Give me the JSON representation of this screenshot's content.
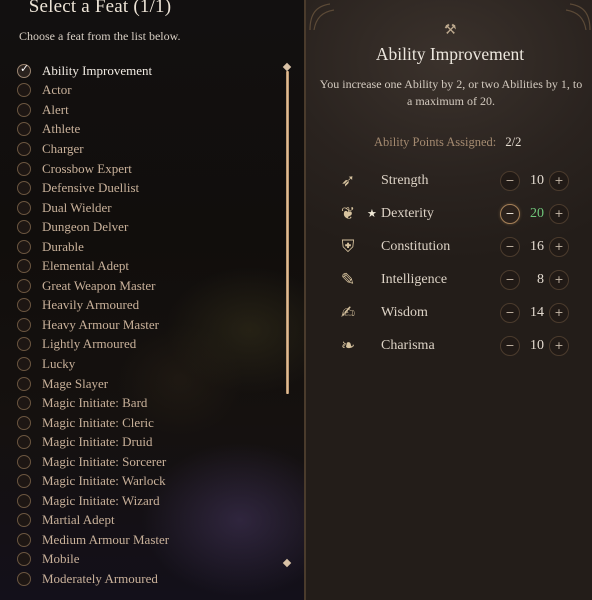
{
  "left": {
    "title": "Select a Feat (1/1)",
    "subtitle": "Choose a feat from the list below.",
    "feats": [
      {
        "label": "Ability Improvement",
        "selected": true
      },
      {
        "label": "Actor",
        "selected": false
      },
      {
        "label": "Alert",
        "selected": false
      },
      {
        "label": "Athlete",
        "selected": false
      },
      {
        "label": "Charger",
        "selected": false
      },
      {
        "label": "Crossbow Expert",
        "selected": false
      },
      {
        "label": "Defensive Duellist",
        "selected": false
      },
      {
        "label": "Dual Wielder",
        "selected": false
      },
      {
        "label": "Dungeon Delver",
        "selected": false
      },
      {
        "label": "Durable",
        "selected": false
      },
      {
        "label": "Elemental Adept",
        "selected": false
      },
      {
        "label": "Great Weapon Master",
        "selected": false
      },
      {
        "label": "Heavily Armoured",
        "selected": false
      },
      {
        "label": "Heavy Armour Master",
        "selected": false
      },
      {
        "label": "Lightly Armoured",
        "selected": false
      },
      {
        "label": "Lucky",
        "selected": false
      },
      {
        "label": "Mage Slayer",
        "selected": false
      },
      {
        "label": "Magic Initiate: Bard",
        "selected": false
      },
      {
        "label": "Magic Initiate: Cleric",
        "selected": false
      },
      {
        "label": "Magic Initiate: Druid",
        "selected": false
      },
      {
        "label": "Magic Initiate: Sorcerer",
        "selected": false
      },
      {
        "label": "Magic Initiate: Warlock",
        "selected": false
      },
      {
        "label": "Magic Initiate: Wizard",
        "selected": false
      },
      {
        "label": "Martial Adept",
        "selected": false
      },
      {
        "label": "Medium Armour Master",
        "selected": false
      },
      {
        "label": "Mobile",
        "selected": false
      },
      {
        "label": "Moderately Armoured",
        "selected": false
      }
    ]
  },
  "detail": {
    "icon": "crossed-hammers-icon",
    "title": "Ability Improvement",
    "description": "You increase one Ability by 2, or two Abilities by 1, to a maximum of 20.",
    "points_label": "Ability Points Assigned:",
    "points_value": "2/2",
    "abilities": [
      {
        "name": "Strength",
        "value": "10",
        "icon": "strength-icon",
        "glyph": "➶",
        "starred": false,
        "max": false
      },
      {
        "name": "Dexterity",
        "value": "20",
        "icon": "dexterity-icon",
        "glyph": "❦",
        "starred": true,
        "max": true
      },
      {
        "name": "Constitution",
        "value": "16",
        "icon": "constitution-icon",
        "glyph": "⛨",
        "starred": false,
        "max": false
      },
      {
        "name": "Intelligence",
        "value": "8",
        "icon": "intelligence-icon",
        "glyph": "✎",
        "starred": false,
        "max": false
      },
      {
        "name": "Wisdom",
        "value": "14",
        "icon": "wisdom-icon",
        "glyph": "✍",
        "starred": false,
        "max": false
      },
      {
        "name": "Charisma",
        "value": "10",
        "icon": "charisma-icon",
        "glyph": "❧",
        "starred": false,
        "max": false
      }
    ],
    "star_glyph": "★",
    "minus_glyph": "−",
    "plus_glyph": "+"
  }
}
